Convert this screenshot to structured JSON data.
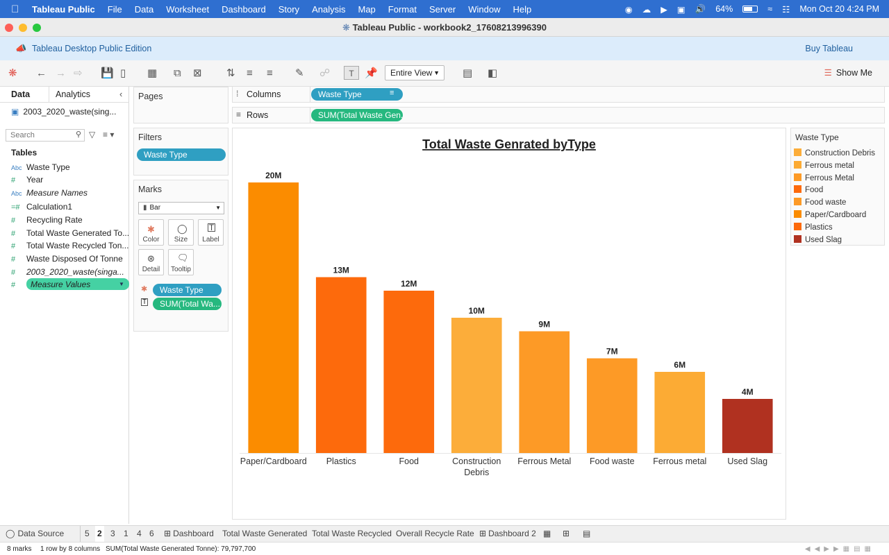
{
  "menubar": {
    "app": "Tableau Public",
    "items": [
      "File",
      "Data",
      "Worksheet",
      "Dashboard",
      "Story",
      "Analysis",
      "Map",
      "Format",
      "Server",
      "Window",
      "Help"
    ],
    "battery": "64%",
    "datetime": "Mon Oct 20  4:24 PM"
  },
  "window": {
    "title": "Tableau Public - workbook2_17608213996390"
  },
  "banner": {
    "edition": "Tableau Desktop Public Edition",
    "buy": "Buy Tableau"
  },
  "toolbar": {
    "fit": "Entire View",
    "show_me": "Show Me"
  },
  "data_pane": {
    "tabs": [
      "Data",
      "Analytics"
    ],
    "datasource": "2003_2020_waste(sing...",
    "search_placeholder": "Search",
    "tables_label": "Tables",
    "fields": [
      {
        "type": "Abc",
        "name": "Waste Type"
      },
      {
        "type": "#",
        "name": "Year"
      },
      {
        "type": "Abc",
        "name": "Measure Names"
      },
      {
        "type": "=#",
        "name": "Calculation1"
      },
      {
        "type": "#",
        "name": "Recycling Rate"
      },
      {
        "type": "#",
        "name": "Total Waste Generated To..."
      },
      {
        "type": "#",
        "name": "Total Waste Recycled Ton..."
      },
      {
        "type": "#",
        "name": "Waste Disposed Of Tonne"
      },
      {
        "type": "#",
        "name": "2003_2020_waste(singa..."
      },
      {
        "type": "#",
        "name": "Measure Values"
      }
    ]
  },
  "cards": {
    "pages": "Pages",
    "filters": "Filters",
    "filter_pill": "Waste Type",
    "marks": "Marks",
    "mark_type": "Bar",
    "mark_buttons": [
      "Color",
      "Size",
      "Label",
      "Detail",
      "Tooltip"
    ],
    "color_pill": "Waste Type",
    "label_pill": "SUM(Total Wa..."
  },
  "shelves": {
    "columns_label": "Columns",
    "columns_pill": "Waste Type",
    "rows_label": "Rows",
    "rows_pill": "SUM(Total Waste Gen.."
  },
  "chart_data": {
    "type": "bar",
    "title": "Total Waste Genrated byType",
    "categories": [
      "Paper/Cardboard",
      "Plastics",
      "Food",
      "Construction Debris",
      "Ferrous Metal",
      "Food waste",
      "Ferrous metal",
      "Used Slag"
    ],
    "values": [
      20,
      13,
      12,
      10,
      9,
      7,
      6,
      4
    ],
    "value_labels": [
      "20M",
      "13M",
      "12M",
      "10M",
      "9M",
      "7M",
      "6M",
      "4M"
    ],
    "colors": [
      "#fb8c00",
      "#fd6a0c",
      "#fd6a0c",
      "#fcad3a",
      "#fd9a26",
      "#fd9a26",
      "#fcab34",
      "#b03120"
    ],
    "ylim": [
      0,
      20
    ],
    "grid": false
  },
  "legend": {
    "title": "Waste Type",
    "items": [
      {
        "label": "Construction Debris",
        "color": "#fcad3a"
      },
      {
        "label": "Ferrous metal",
        "color": "#fcab34"
      },
      {
        "label": "Ferrous Metal",
        "color": "#fd9a26"
      },
      {
        "label": "Food",
        "color": "#fd6a0c"
      },
      {
        "label": "Food waste",
        "color": "#fd9a26"
      },
      {
        "label": "Paper/Cardboard",
        "color": "#fb8c00"
      },
      {
        "label": "Plastics",
        "color": "#fd6a0c"
      },
      {
        "label": "Used Slag",
        "color": "#b03120"
      }
    ]
  },
  "sheet_tabs": [
    "Data Source",
    "5",
    "2",
    "3",
    "1",
    "4",
    "6",
    "Dashboard",
    "Total Waste Generated",
    "Total Waste Recycled",
    "Overall Recycle Rate",
    "Dashboard 2"
  ],
  "status": {
    "marks": "8 marks",
    "dims": "1 row by 8 columns",
    "sum": "SUM(Total Waste Generated Tonne): 79,797,700"
  }
}
